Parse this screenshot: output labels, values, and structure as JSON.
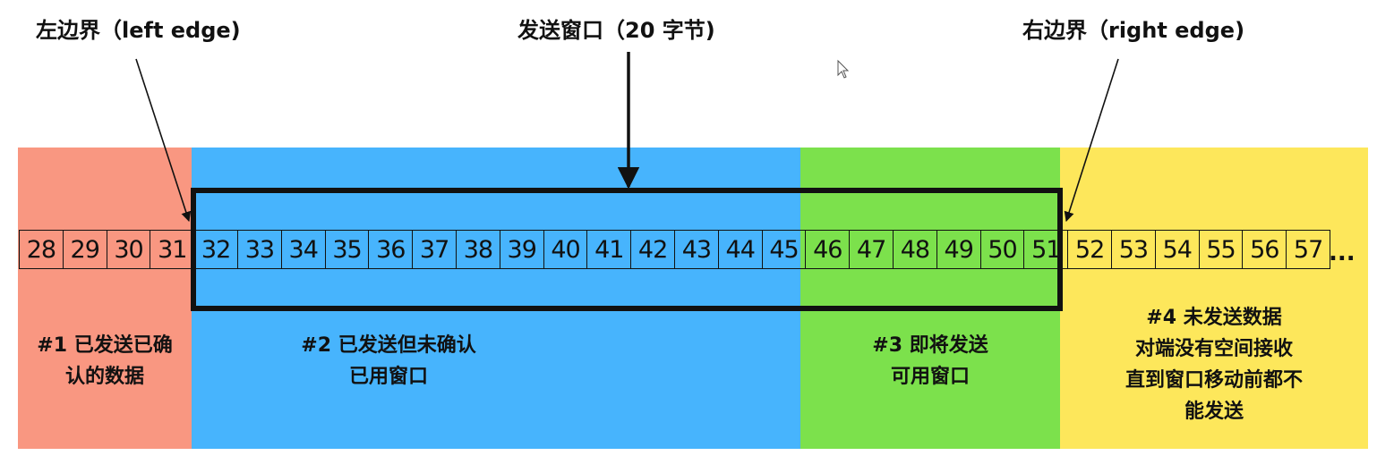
{
  "labels": {
    "left_edge": "左边界（left edge)",
    "send_window": "发送窗口（20 字节)",
    "right_edge": "右边界（right edge)"
  },
  "zones": [
    {
      "id": "acked",
      "color": "#f99781",
      "lines": [
        "#1 已发送已确",
        "认的数据"
      ]
    },
    {
      "id": "in-flight",
      "color": "#47b4fd",
      "lines": [
        "#2 已发送但未确认",
        "已用窗口"
      ]
    },
    {
      "id": "usable",
      "color": "#7ce14c",
      "lines": [
        "#3 即将发送",
        "可用窗口"
      ]
    },
    {
      "id": "not-sendable",
      "color": "#fde75b",
      "lines": [
        "#4 未发送数据",
        "对端没有空间接收",
        "直到窗口移动前都不",
        "能发送"
      ]
    }
  ],
  "bytes": [
    "28",
    "29",
    "30",
    "31",
    "32",
    "33",
    "34",
    "35",
    "36",
    "37",
    "38",
    "39",
    "40",
    "41",
    "42",
    "43",
    "44",
    "45",
    "46",
    "47",
    "48",
    "49",
    "50",
    "51",
    "52",
    "53",
    "54",
    "55",
    "56",
    "57"
  ],
  "ellipsis": "..."
}
